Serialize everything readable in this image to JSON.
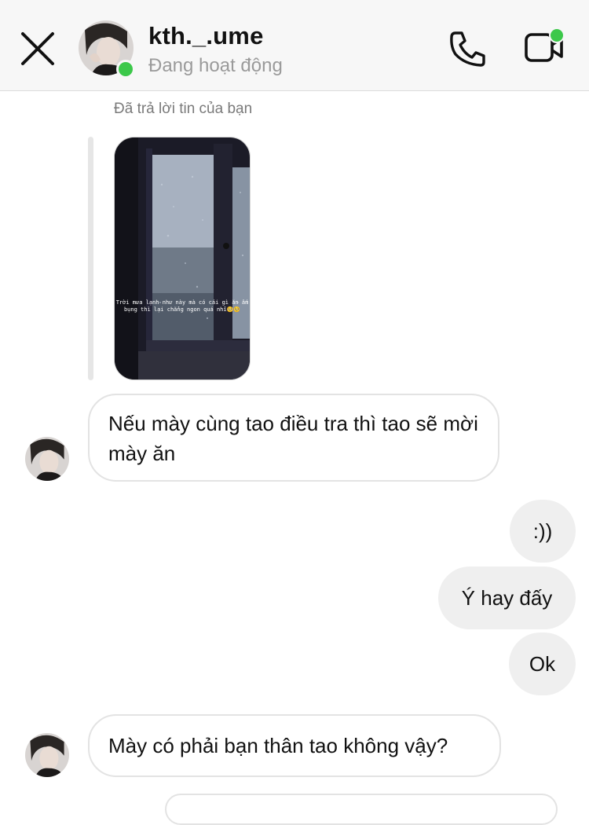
{
  "header": {
    "username": "kth._.ume",
    "status": "Đang hoạt động",
    "online_color": "#3cc84a",
    "icons": [
      "close-icon",
      "phone-icon",
      "video-camera-icon"
    ]
  },
  "reply": {
    "note": "Đã trả lời tin của bạn",
    "story_caption": "Trời mưa lạnh như này mà có cái gì ăn ấm bụng thì lại chẳng ngon quá nhỉ🥺🥺"
  },
  "messages": [
    {
      "side": "in",
      "text": "Nếu mày cùng tao điều tra thì tao sẽ mời mày ăn"
    },
    {
      "side": "out",
      "text": ":))"
    },
    {
      "side": "out",
      "text": "Ý hay đấy"
    },
    {
      "side": "out",
      "text": "Ok"
    },
    {
      "side": "in",
      "text": "Mày có phải bạn thân tao không vậy?"
    }
  ]
}
